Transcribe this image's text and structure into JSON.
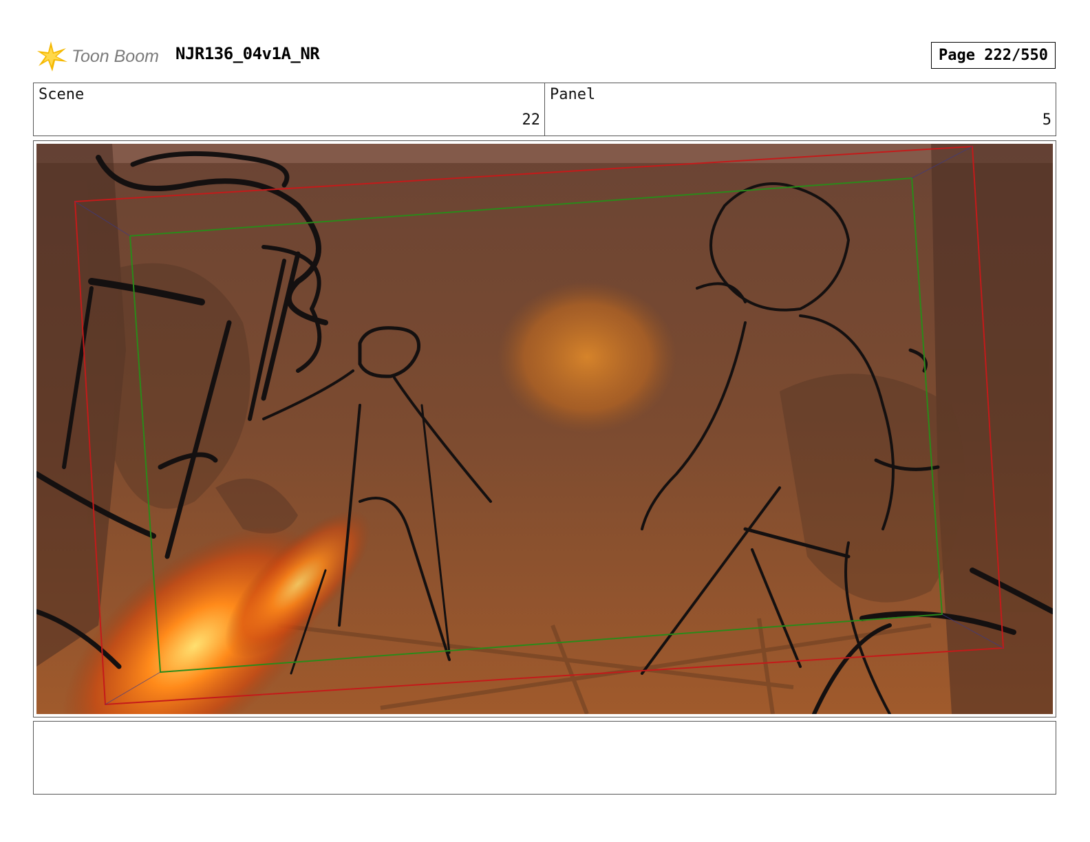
{
  "header": {
    "brand": "Toon Boom",
    "project_title": "NJR136_04v1A_NR",
    "page_label": "Page 222/550"
  },
  "scene": {
    "label": "Scene",
    "value": "22"
  },
  "panel": {
    "label": "Panel",
    "value": "5"
  },
  "notes": {
    "text": ""
  },
  "colors": {
    "camera_outer": "#c41a1a",
    "camera_inner": "#2a8a1a",
    "fire": "#ff7a10",
    "background": "#7a4a30"
  }
}
